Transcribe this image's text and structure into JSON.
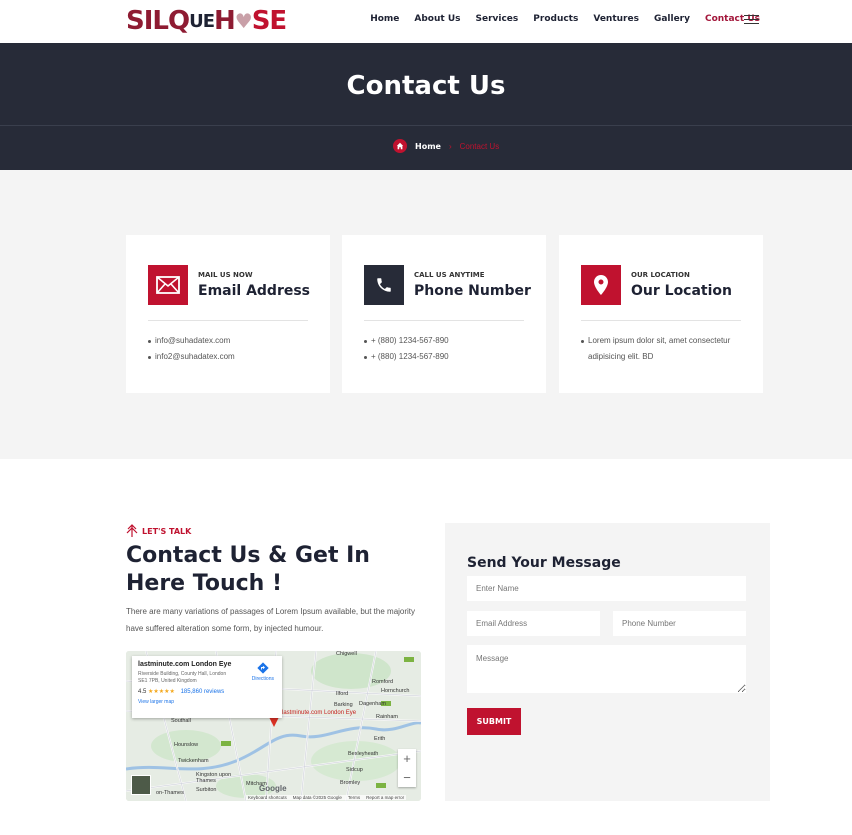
{
  "header": {
    "logo_parts": [
      "SILQ",
      "UE",
      "H",
      "SE"
    ],
    "nav": [
      "Home",
      "About Us",
      "Services",
      "Products",
      "Ventures",
      "Gallery",
      "Contact Us"
    ],
    "active_nav": "Contact Us"
  },
  "banner": {
    "title": "Contact Us",
    "breadcrumb_home": "Home",
    "breadcrumb_separator": "›",
    "breadcrumb_current": "Contact Us"
  },
  "cards": [
    {
      "icon": "envelope-icon",
      "kicker": "MAIL US NOW",
      "title": "Email Address",
      "items": [
        "info@suhadatex.com",
        "info2@suhadatex.com"
      ]
    },
    {
      "icon": "phone-icon",
      "kicker": "CALL US ANYTIME",
      "title": "Phone Number",
      "items": [
        "+ (880) 1234-567-890",
        "+ (880) 1234-567-890"
      ]
    },
    {
      "icon": "location-pin-icon",
      "kicker": "OUR LOCATION",
      "title": "Our Location",
      "items": [
        "Lorem ipsum dolor sit, amet consectetur adipisicing elit. BD"
      ]
    }
  ],
  "talk": {
    "tag": "LET'S TALK",
    "title": "Contact Us & Get In Here Touch !",
    "description": "There are many variations of passages of Lorem Ipsum available, but the majority have suffered alteration some form, by injected humour."
  },
  "map": {
    "place_name": "lastminute.com London Eye",
    "address": "Riverside Building, County Hall, London SE1 7PB, United Kingdom",
    "rating": "4.5",
    "stars": "★★★★★",
    "reviews": "185,860 reviews",
    "larger_map": "View larger map",
    "directions": "Directions",
    "pin_label": "lastminute.com London Eye",
    "places": [
      {
        "name": "Chigwell"
      },
      {
        "name": "Romford"
      },
      {
        "name": "Hornchurch"
      },
      {
        "name": "Ilford"
      },
      {
        "name": "Barking"
      },
      {
        "name": "Dagenham"
      },
      {
        "name": "Rainham"
      },
      {
        "name": "Southall"
      },
      {
        "name": "Hounslow"
      },
      {
        "name": "Twickenham"
      },
      {
        "name": "Kingston upon Thames"
      },
      {
        "name": "Surbiton"
      },
      {
        "name": "Erith"
      },
      {
        "name": "Bexleyheath"
      },
      {
        "name": "Sidcup"
      },
      {
        "name": "Bromley"
      },
      {
        "name": "Mitcham"
      },
      {
        "name": "on-Thames"
      }
    ],
    "footer": [
      "Keyboard shortcuts",
      "Map data ©2025 Google",
      "Terms",
      "Report a map error"
    ],
    "wordmark": "Google",
    "zoom_in": "+",
    "zoom_out": "−"
  },
  "form": {
    "heading": "Send Your Message",
    "name_placeholder": "Enter Name",
    "email_placeholder": "Email Address",
    "phone_placeholder": "Phone Number",
    "message_placeholder": "Message",
    "submit_label": "SUBMIT"
  },
  "colors": {
    "accent": "#c0122f",
    "dark": "#272b38",
    "nav_active": "#a3173b"
  }
}
